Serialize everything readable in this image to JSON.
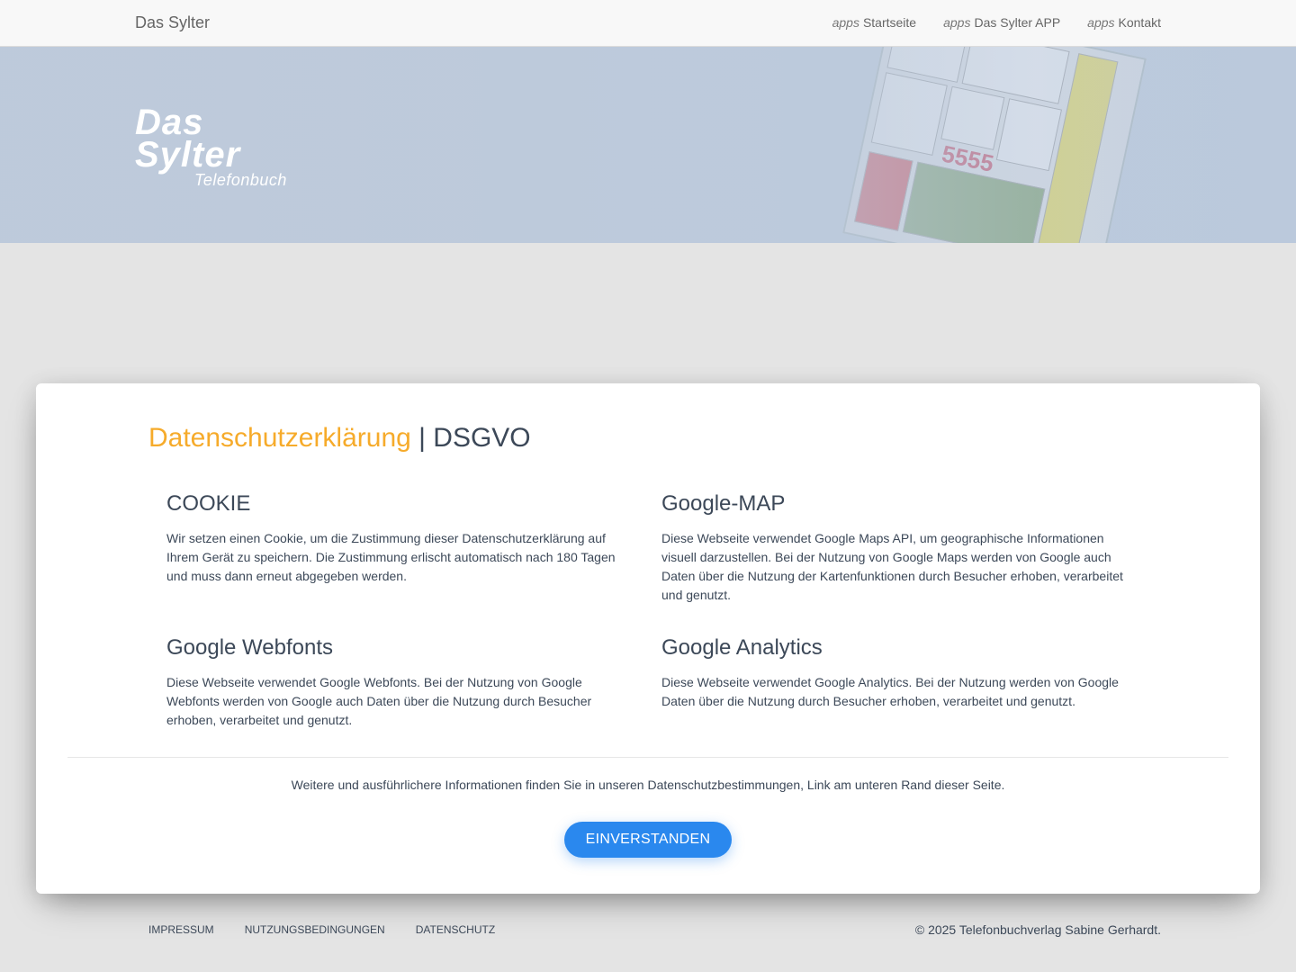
{
  "navbar": {
    "brand": "Das Sylter",
    "items": [
      {
        "icon": "apps",
        "label": "Startseite"
      },
      {
        "icon": "apps",
        "label": "Das Sylter APP"
      },
      {
        "icon": "apps",
        "label": "Kontakt"
      }
    ]
  },
  "hero": {
    "logo_line1": "Das",
    "logo_line2": "Sylter",
    "logo_line3": "Telefonbuch"
  },
  "dialog": {
    "title_accent": "Datenschutzerklärung",
    "title_rest": " | DSGVO",
    "sections": [
      {
        "heading": "COOKIE",
        "text": "Wir setzen einen Cookie, um die Zustimmung dieser Datenschutzerklärung auf Ihrem Gerät zu speichern. Die Zustimmung erlischt automatisch nach 180 Tagen und muss dann erneut abgegeben werden."
      },
      {
        "heading": "Google-MAP",
        "text": "Diese Webseite verwendet Google Maps API, um geographische Informationen visuell darzustellen. Bei der Nutzung von Google Maps werden von Google auch Daten über die Nutzung der Kartenfunktionen durch Besucher erhoben, verarbeitet und genutzt."
      },
      {
        "heading": "Google Webfonts",
        "text": "Diese Webseite verwendet Google Webfonts. Bei der Nutzung von Google Webfonts werden von Google auch Daten über die Nutzung durch Besucher erhoben, verarbeitet und genutzt."
      },
      {
        "heading": "Google Analytics",
        "text": "Diese Webseite verwendet Google Analytics. Bei der Nutzung werden von Google Daten über die Nutzung durch Besucher erhoben, verarbeitet und genutzt."
      }
    ],
    "more_info": "Weitere und ausführlichere Informationen finden Sie in unseren Datenschutzbestimmungen, Link am unteren Rand dieser Seite.",
    "accept_label": "EINVERSTANDEN"
  },
  "footer": {
    "links": [
      "IMPRESSUM",
      "NUTZUNGSBEDINGUNGEN",
      "DATENSCHUTZ"
    ],
    "copyright": "© 2025 Telefonbuchverlag Sabine Gerhardt."
  },
  "colors": {
    "accent": "#f6ab2b",
    "button": "#2a88ee",
    "text": "#3c4858",
    "hero": "#bccadd"
  }
}
